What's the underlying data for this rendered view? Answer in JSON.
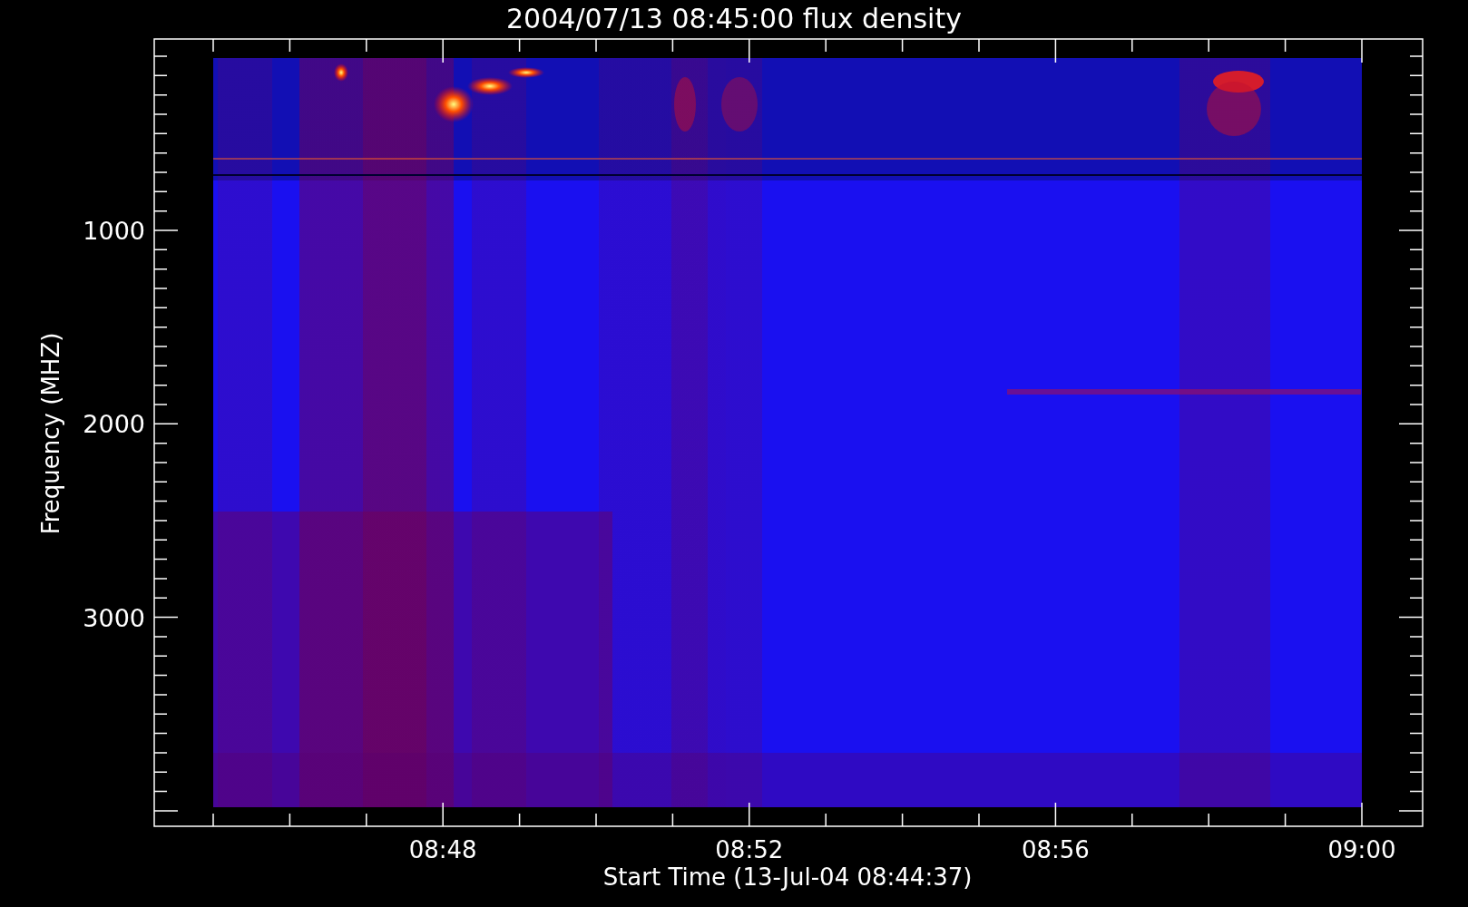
{
  "plot": {
    "title": "2004/07/13 08:45:00 flux density",
    "ylabel": "Frequency (MHZ)",
    "xlabel": "Start Time (13-Jul-04 08:44:37)",
    "y_tick_labels": [
      "1000",
      "2000",
      "3000"
    ],
    "x_tick_labels": [
      "08:48",
      "08:52",
      "08:56",
      "09:00"
    ]
  }
}
